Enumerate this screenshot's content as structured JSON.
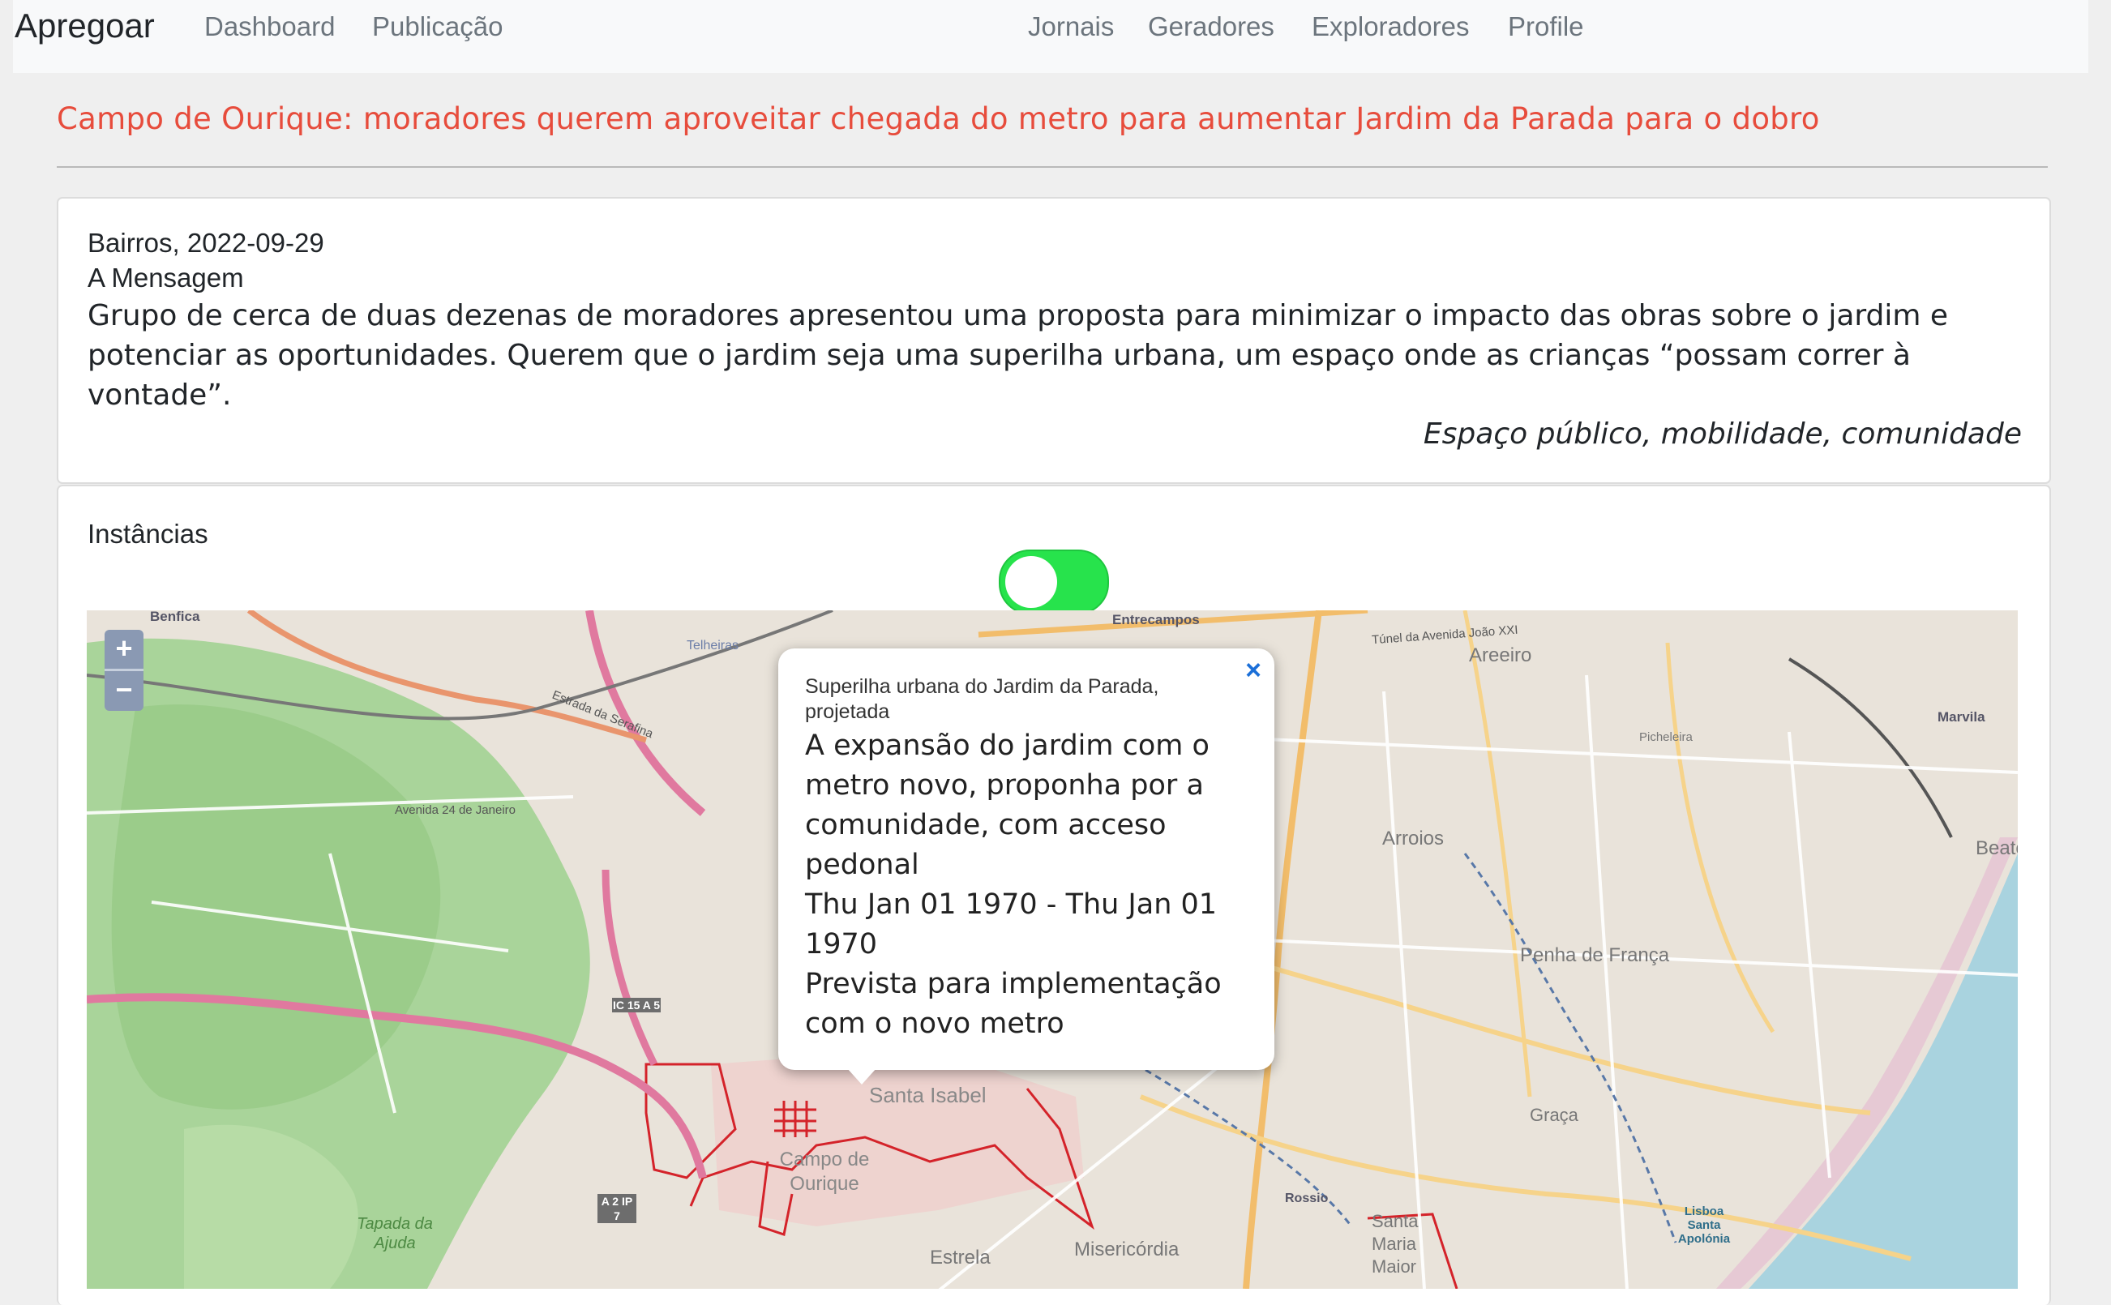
{
  "navbar": {
    "brand": "Apregoar",
    "left_links": [
      "Dashboard",
      "Publicação"
    ],
    "right_links": [
      "Jornais",
      "Geradores",
      "Exploradores",
      "Profile"
    ]
  },
  "article": {
    "title": "Campo de Ourique: moradores querem aproveitar chegada do metro para aumentar Jardim da Parada para o dobro"
  },
  "message_card": {
    "date_line": "Bairros, 2022-09-29",
    "heading": "A Mensagem",
    "body": "Grupo de cerca de duas dezenas de moradores apresentou uma proposta para minimizar o impacto das obras sobre o jardim e potenciar as oportunidades. Querem que o jardim seja uma superilha urbana, um espaço onde as crianças “possam correr à vontade”.",
    "tags": "Espaço público, mobilidade, comunidade"
  },
  "instances_card": {
    "heading": "Instâncias",
    "toggle_on": true,
    "toggle_color": "#27e34c"
  },
  "map": {
    "zoom_in": "+",
    "zoom_out": "−",
    "labels": [
      "Benfica",
      "Entrecampos",
      "Areeiro",
      "Marvila",
      "Telheiras",
      "Arroios",
      "Penha de França",
      "Beato",
      "Graça",
      "Santa Isabel",
      "Campo de Ourique",
      "Estrela",
      "Misericórdia",
      "Santa Maria Maior",
      "Rossio",
      "Tapada da Ajuda",
      "Lisboa Santa Apolónia",
      "Estrada da Serafina",
      "Avenida 24 de Janeiro",
      "IC 15 A 5",
      "A 2 IP 7",
      "Túnel da Avenida João XXI",
      "Picheleira"
    ],
    "popup": {
      "close": "×",
      "subtitle": "Superilha urbana do Jardim da Parada, projetada",
      "description": "A expansão do jardim com o metro novo, proponha por a comunidade, com acceso pedonal",
      "dates": "Thu Jan 01 1970 - Thu Jan 01 1970",
      "status": "Prevista para implementação com o novo metro"
    }
  }
}
